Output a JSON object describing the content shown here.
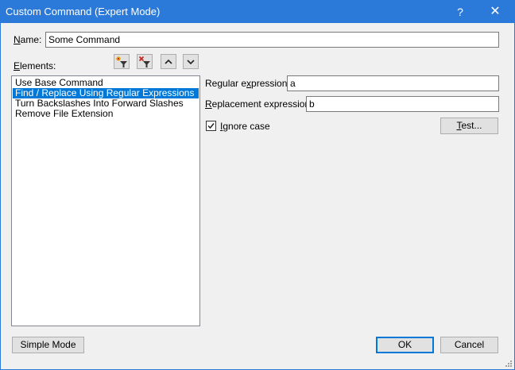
{
  "window": {
    "title": "Custom Command (Expert Mode)",
    "help_glyph": "?",
    "close_glyph": "✕"
  },
  "name": {
    "label_underlined": "N",
    "label_rest": "ame:",
    "value": "Some Command"
  },
  "elements": {
    "label_underlined": "E",
    "label_rest": "lements:",
    "toolbar": [
      {
        "icon": "add-filter-icon"
      },
      {
        "icon": "remove-filter-icon"
      },
      {
        "icon": "chevron-up-icon"
      },
      {
        "icon": "chevron-down-icon"
      }
    ],
    "items": [
      {
        "label": "Use Base Command",
        "selected": false
      },
      {
        "label": "Find / Replace Using Regular Expressions",
        "selected": true
      },
      {
        "label": "Turn Backslashes Into Forward Slashes",
        "selected": false
      },
      {
        "label": "Remove File Extension",
        "selected": false
      }
    ]
  },
  "details": {
    "regex_label_pre": "Regular e",
    "regex_label_underlined": "x",
    "regex_label_post": "pression:",
    "regex_value": "a",
    "replacement_label_underlined": "R",
    "replacement_label_rest": "eplacement expression:",
    "replacement_value": "b",
    "ignore_case_underlined": "I",
    "ignore_case_rest": "gnore case",
    "ignore_case_checked": true,
    "test_underlined": "T",
    "test_rest": "est..."
  },
  "footer": {
    "simple_mode": "Simple Mode",
    "ok": "OK",
    "cancel": "Cancel"
  },
  "colors": {
    "titlebar": "#2b79d8",
    "selection": "#0078d7"
  }
}
